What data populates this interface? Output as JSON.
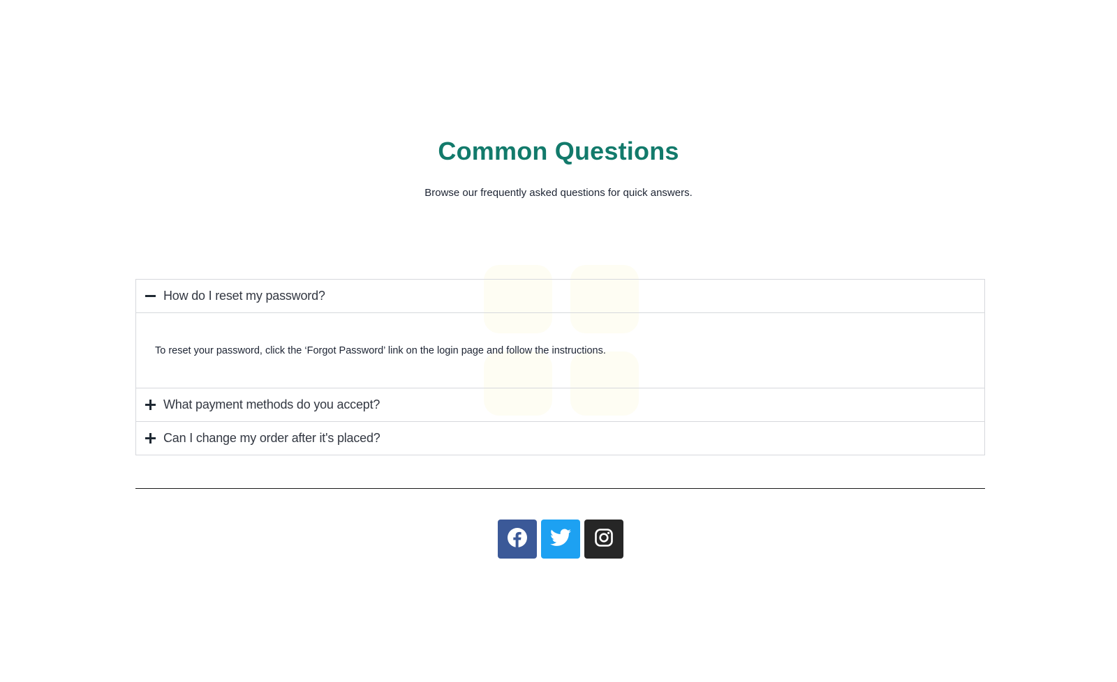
{
  "faq": {
    "title": "Common Questions",
    "subtitle": "Browse our frequently asked questions for quick answers.",
    "items": [
      {
        "question": "How do I reset my password?",
        "expanded": true,
        "icon": "minus-icon",
        "answer": "To reset your password, click the ‘Forgot Password’ link on the login page and follow the instructions."
      },
      {
        "question": "What payment methods do you accept?",
        "expanded": false,
        "icon": "plus-icon"
      },
      {
        "question": "Can I change my order after it's placed?",
        "expanded": false,
        "icon": "plus-icon"
      }
    ]
  },
  "social": {
    "links": [
      {
        "name": "facebook",
        "icon": "facebook-icon",
        "color": "#3b5998"
      },
      {
        "name": "twitter",
        "icon": "twitter-icon",
        "color": "#1da1f2"
      },
      {
        "name": "instagram",
        "icon": "instagram-icon",
        "color": "#262626"
      }
    ]
  },
  "colors": {
    "title": "#127a6b",
    "border": "#d6d8dc",
    "divider": "#1a1a1a"
  }
}
